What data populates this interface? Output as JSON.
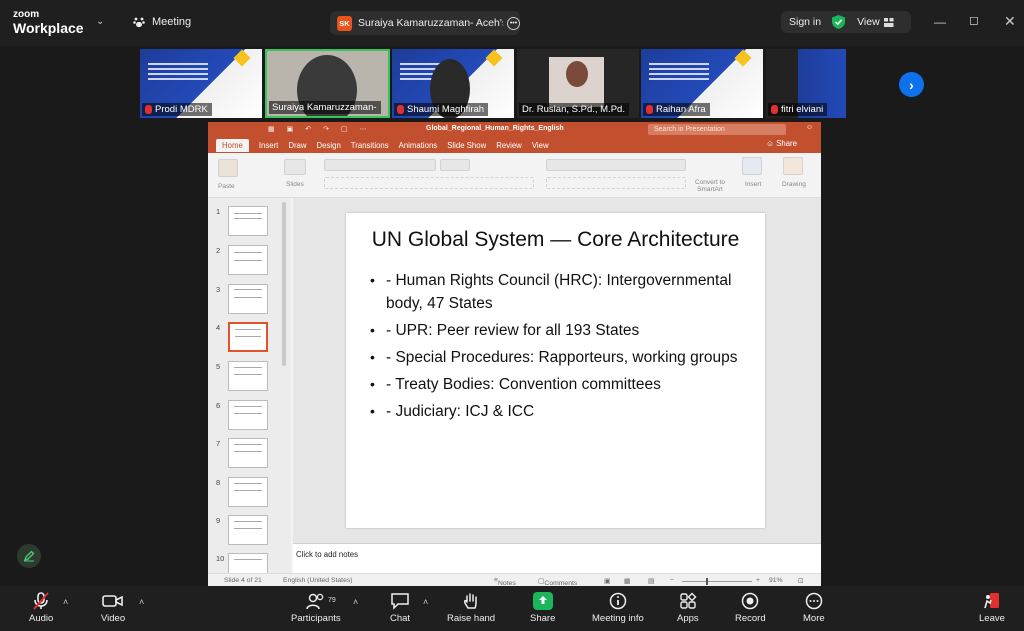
{
  "app": {
    "logo_top": "zoom",
    "logo_bottom": "Workplace",
    "meeting_label": "Meeting"
  },
  "share_tab": {
    "badge": "SK",
    "title": "Suraiya Kamaruzzaman- Aceh's sc"
  },
  "header_right": {
    "sign_in": "Sign in",
    "view": "View"
  },
  "participants": [
    {
      "name": "Prodi MDRK"
    },
    {
      "name": "Suraiya Kamaruzzaman-"
    },
    {
      "name": "Shaumi Maghfirah"
    },
    {
      "name": "Dr. Ruslan, S.Pd., M.Pd."
    },
    {
      "name": "Raihan Afra"
    },
    {
      "name": "fitri elviani"
    }
  ],
  "powerpoint": {
    "doc_title": "Global_Regional_Human_Rights_English",
    "search_placeholder": "Search in Presentation",
    "tabs": [
      "Home",
      "Insert",
      "Draw",
      "Design",
      "Transitions",
      "Animations",
      "Slide Show",
      "Review",
      "View"
    ],
    "share": "Share",
    "ribbon": {
      "paste": "Paste",
      "slides": "Slides",
      "convert": "Convert to SmartArt",
      "insert": "Insert",
      "drawing": "Drawing"
    },
    "thumbnail_numbers": [
      "1",
      "2",
      "3",
      "4",
      "5",
      "6",
      "7",
      "8",
      "9",
      "10"
    ],
    "selected_thumbnail": 4,
    "slide": {
      "title": "UN Global System — Core Architecture",
      "bullets": [
        "- Human Rights Council (HRC): Intergovernmental body, 47 States",
        "- UPR: Peer review for all 193 States",
        "- Special Procedures: Rapporteurs, working groups",
        "- Treaty Bodies: Convention committees",
        "- Judiciary: ICJ & ICC"
      ]
    },
    "notes_placeholder": "Click to add notes",
    "status": {
      "slide_of": "Slide 4 of 21",
      "language": "English (United States)",
      "notes": "Notes",
      "comments": "Comments",
      "zoom": "91%"
    }
  },
  "toolbar": {
    "audio": "Audio",
    "video": "Video",
    "participants": "Participants",
    "participants_count": "79",
    "chat": "Chat",
    "raise_hand": "Raise hand",
    "share": "Share",
    "meeting_info": "Meeting info",
    "apps": "Apps",
    "record": "Record",
    "more": "More",
    "leave": "Leave"
  },
  "colors": {
    "ppt_accent": "#c2502f",
    "zoom_blue": "#0e72ed",
    "share_green": "#1bb55c",
    "mic_off_red": "#e03030"
  }
}
